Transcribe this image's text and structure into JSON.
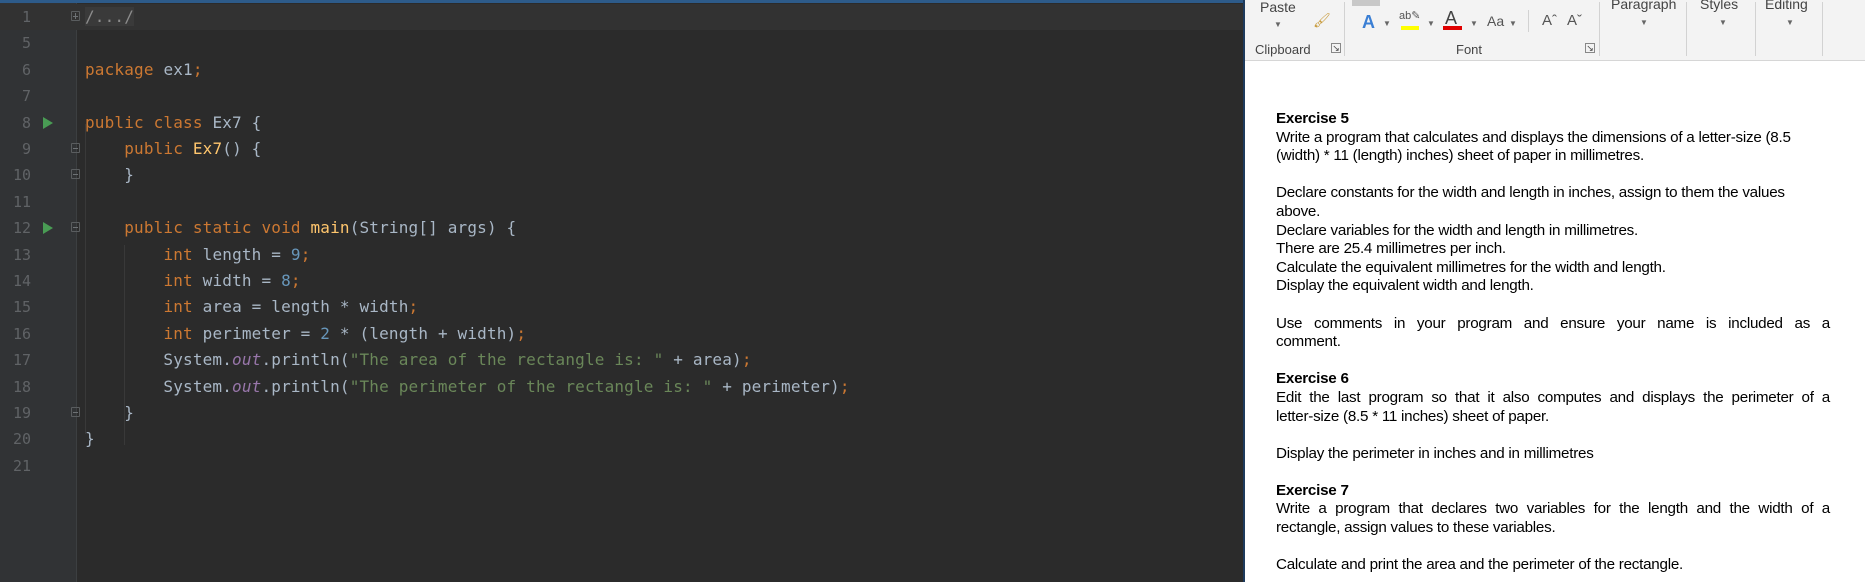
{
  "editor": {
    "lines": [
      {
        "n": "1",
        "current": true,
        "fold": "plus",
        "tokens": [
          [
            "fold",
            "/.../"
          ]
        ]
      },
      {
        "n": "5",
        "tokens": []
      },
      {
        "n": "6",
        "tokens": [
          [
            "kw",
            "package "
          ],
          [
            "txt",
            "ex1"
          ],
          [
            "semi",
            ";"
          ]
        ]
      },
      {
        "n": "7",
        "tokens": []
      },
      {
        "n": "8",
        "run": true,
        "tokens": [
          [
            "kw",
            "public class "
          ],
          [
            "txt",
            "Ex7 {"
          ]
        ]
      },
      {
        "n": "9",
        "fold": "minus",
        "tokens": [
          [
            "txt",
            "    "
          ],
          [
            "kw",
            "public "
          ],
          [
            "fn",
            "Ex7"
          ],
          [
            "txt",
            "() {"
          ]
        ]
      },
      {
        "n": "10",
        "fold": "end",
        "tokens": [
          [
            "txt",
            "    }"
          ]
        ]
      },
      {
        "n": "11",
        "tokens": []
      },
      {
        "n": "12",
        "run": true,
        "fold": "minus",
        "tokens": [
          [
            "txt",
            "    "
          ],
          [
            "kw",
            "public static void "
          ],
          [
            "fn",
            "main"
          ],
          [
            "txt",
            "(String[] args) {"
          ]
        ]
      },
      {
        "n": "13",
        "tokens": [
          [
            "txt",
            "        "
          ],
          [
            "kw",
            "int "
          ],
          [
            "txt",
            "length = "
          ],
          [
            "num",
            "9"
          ],
          [
            "semi",
            ";"
          ]
        ]
      },
      {
        "n": "14",
        "tokens": [
          [
            "txt",
            "        "
          ],
          [
            "kw",
            "int "
          ],
          [
            "txt",
            "width = "
          ],
          [
            "num",
            "8"
          ],
          [
            "semi",
            ";"
          ]
        ]
      },
      {
        "n": "15",
        "tokens": [
          [
            "txt",
            "        "
          ],
          [
            "kw",
            "int "
          ],
          [
            "txt",
            "area = length * width"
          ],
          [
            "semi",
            ";"
          ]
        ]
      },
      {
        "n": "16",
        "tokens": [
          [
            "txt",
            "        "
          ],
          [
            "kw",
            "int "
          ],
          [
            "txt",
            "perimeter = "
          ],
          [
            "num",
            "2"
          ],
          [
            "txt",
            " * (length + width)"
          ],
          [
            "semi",
            ";"
          ]
        ]
      },
      {
        "n": "17",
        "tokens": [
          [
            "txt",
            "        System."
          ],
          [
            "field",
            "out"
          ],
          [
            "txt",
            ".println("
          ],
          [
            "str",
            "\"The area of the rectangle is: \""
          ],
          [
            "txt",
            " + area)"
          ],
          [
            "semi",
            ";"
          ]
        ]
      },
      {
        "n": "18",
        "tokens": [
          [
            "txt",
            "        System."
          ],
          [
            "field",
            "out"
          ],
          [
            "txt",
            ".println("
          ],
          [
            "str",
            "\"The perimeter of the rectangle is: \""
          ],
          [
            "txt",
            " + perimeter)"
          ],
          [
            "semi",
            ";"
          ]
        ]
      },
      {
        "n": "19",
        "fold": "end",
        "tokens": [
          [
            "txt",
            "    }"
          ]
        ]
      },
      {
        "n": "20",
        "tokens": [
          [
            "txt",
            "}"
          ]
        ]
      },
      {
        "n": "21",
        "tokens": []
      }
    ]
  },
  "ribbon": {
    "paste": "Paste",
    "clipboard": "Clipboard",
    "font": "Font",
    "font_case": "Aa",
    "paragraph": "Paragraph",
    "styles": "Styles",
    "editing": "Editing",
    "highlight_color": "#ffff00",
    "font_color": "#e00000"
  },
  "document": {
    "blocks": [
      {
        "type": "h",
        "text": "Exercise 5"
      },
      {
        "type": "p",
        "lines": [
          "Write a program that calculates and displays the dimensions of a letter-size (8.5",
          "(width) * 11 (length) inches) sheet of paper in millimetres."
        ]
      },
      {
        "type": "gap"
      },
      {
        "type": "p",
        "lines": [
          "Declare constants for the width and length in inches, assign to them the values",
          "above.",
          "Declare variables for the width and length in millimetres.",
          "There are 25.4 millimetres per inch.",
          "Calculate the equivalent millimetres for the width and length.",
          "Display the equivalent width and length."
        ]
      },
      {
        "type": "gap"
      },
      {
        "type": "p",
        "justify_first": true,
        "lines": [
          "Use comments in your program and ensure your name is included as a",
          "comment."
        ]
      },
      {
        "type": "gap"
      },
      {
        "type": "h",
        "text": "Exercise 6"
      },
      {
        "type": "p",
        "justify_first": true,
        "lines": [
          "Edit the last program so that it also computes and displays the perimeter of a",
          "letter-size (8.5 * 11 inches) sheet of paper."
        ]
      },
      {
        "type": "gap"
      },
      {
        "type": "p",
        "lines": [
          "Display the perimeter in inches and in millimetres"
        ]
      },
      {
        "type": "gap"
      },
      {
        "type": "h",
        "text": "Exercise 7"
      },
      {
        "type": "p",
        "justify_first": true,
        "lines": [
          "Write a program that declares two variables for the length and the width of a",
          "rectangle, assign values to these variables."
        ]
      },
      {
        "type": "gap"
      },
      {
        "type": "p",
        "lines": [
          "Calculate and print the area and the perimeter of the rectangle."
        ]
      }
    ]
  }
}
